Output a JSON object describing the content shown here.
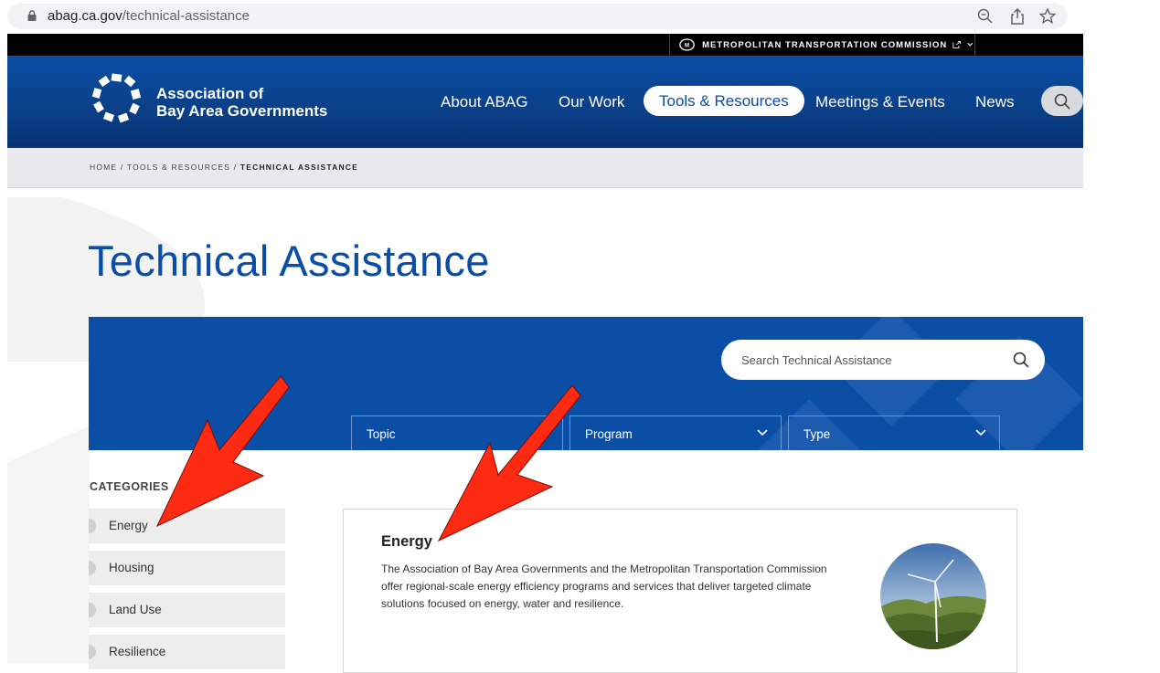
{
  "browser": {
    "url_domain": "abag.ca.gov",
    "url_path": "/technical-assistance"
  },
  "mtc_bar": {
    "label": "METROPOLITAN TRANSPORTATION COMMISSION"
  },
  "header": {
    "brand_line1": "Association of",
    "brand_line2": "Bay Area Governments",
    "nav": [
      {
        "label": "About ABAG"
      },
      {
        "label": "Our Work"
      },
      {
        "label": "Tools & Resources"
      },
      {
        "label": "Meetings & Events"
      },
      {
        "label": "News"
      }
    ],
    "active_nav": "Tools & Resources"
  },
  "breadcrumb": {
    "home": "HOME",
    "parent": "TOOLS & RESOURCES",
    "current": "TECHNICAL ASSISTANCE",
    "separator": "/"
  },
  "page": {
    "title": "Technical Assistance"
  },
  "filter": {
    "search_placeholder": "Search Technical Assistance",
    "dropdowns": [
      {
        "label": "Topic"
      },
      {
        "label": "Program"
      },
      {
        "label": "Type"
      }
    ]
  },
  "categories": {
    "heading": "CATEGORIES",
    "items": [
      {
        "label": "Energy"
      },
      {
        "label": "Housing"
      },
      {
        "label": "Land Use"
      },
      {
        "label": "Resilience"
      }
    ]
  },
  "card": {
    "title": "Energy",
    "description": "The Association of Bay Area Governments and the Metropolitan Transportation Commission offer regional-scale energy efficiency programs and services that deliver targeted climate solutions focused on energy, water and resilience."
  },
  "colors": {
    "brand_blue": "#0b4ea6",
    "annotation_arrow": "#ff2a12"
  }
}
